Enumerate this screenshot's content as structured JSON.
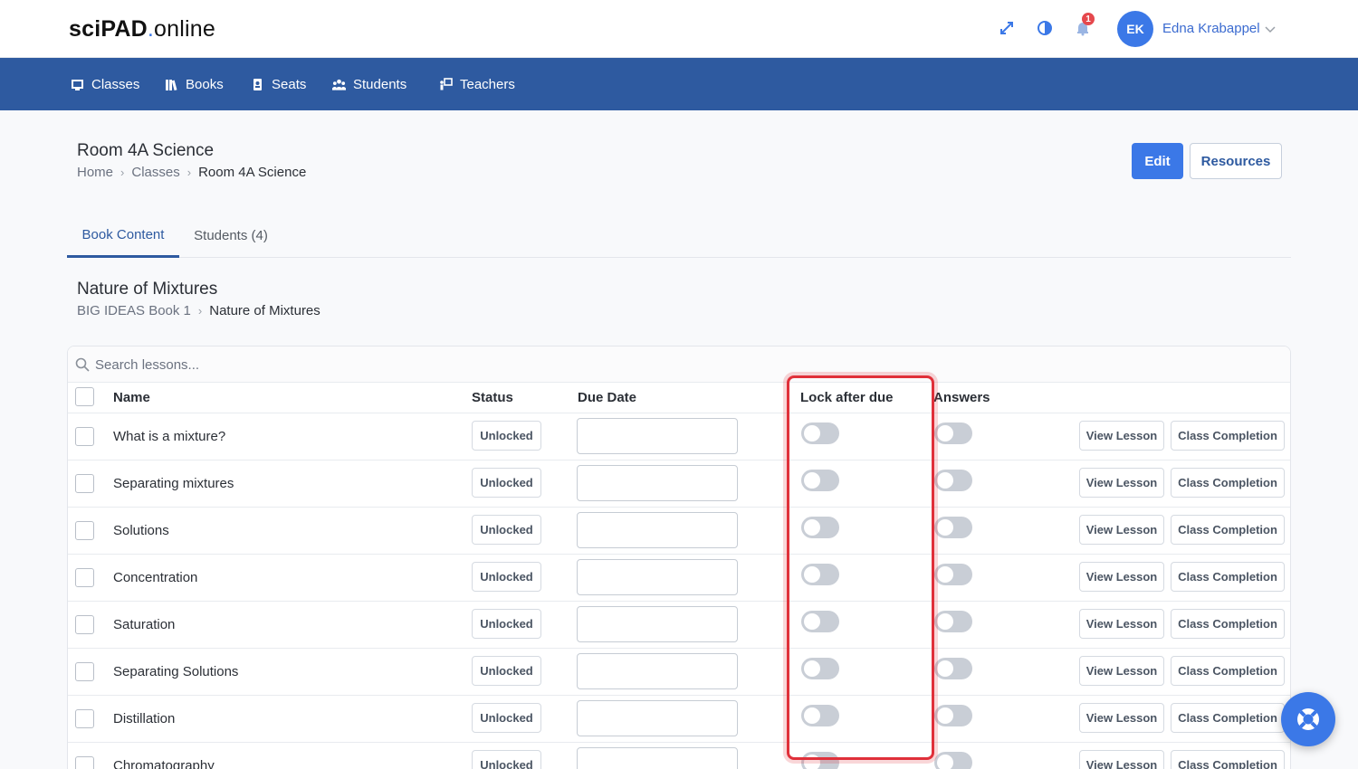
{
  "header": {
    "logo_bold": "sciPAD",
    "logo_dot": ".",
    "logo_rest": "online",
    "icons": [
      "expand-icon",
      "contrast-icon",
      "bell-icon"
    ],
    "notification_count": "1",
    "avatar_initials": "EK",
    "username": "Edna Krabappel"
  },
  "nav": {
    "items": [
      {
        "label": "Classes",
        "icon": "classes-icon"
      },
      {
        "label": "Books",
        "icon": "books-icon"
      },
      {
        "label": "Seats",
        "icon": "seats-icon"
      },
      {
        "label": "Students",
        "icon": "students-icon"
      },
      {
        "label": "Teachers",
        "icon": "teachers-icon"
      }
    ]
  },
  "page": {
    "title": "Room 4A Science",
    "breadcrumb": [
      "Home",
      "Classes",
      "Room 4A Science"
    ],
    "edit_label": "Edit",
    "resources_label": "Resources"
  },
  "tabs": [
    {
      "label": "Book Content",
      "active": true
    },
    {
      "label": "Students (4)",
      "active": false
    }
  ],
  "section": {
    "title": "Nature of Mixtures",
    "breadcrumb": [
      "BIG IDEAS Book 1",
      "Nature of Mixtures"
    ]
  },
  "table": {
    "search_placeholder": "Search lessons...",
    "columns": {
      "name": "Name",
      "status": "Status",
      "due_date": "Due Date",
      "lock_after_due": "Lock after due",
      "answers": "Answers"
    },
    "view_label": "View Lesson",
    "completion_label": "Class Completion",
    "rows": [
      {
        "name": "What is a mixture?",
        "status": "Unlocked"
      },
      {
        "name": "Separating mixtures",
        "status": "Unlocked"
      },
      {
        "name": "Solutions",
        "status": "Unlocked"
      },
      {
        "name": "Concentration",
        "status": "Unlocked"
      },
      {
        "name": "Saturation",
        "status": "Unlocked"
      },
      {
        "name": "Separating Solutions",
        "status": "Unlocked"
      },
      {
        "name": "Distillation",
        "status": "Unlocked"
      },
      {
        "name": "Chromatography",
        "status": "Unlocked"
      }
    ]
  },
  "colors": {
    "accent": "#3b78e7",
    "nav_bg": "#2e5aa0",
    "highlight": "#e0303a"
  }
}
